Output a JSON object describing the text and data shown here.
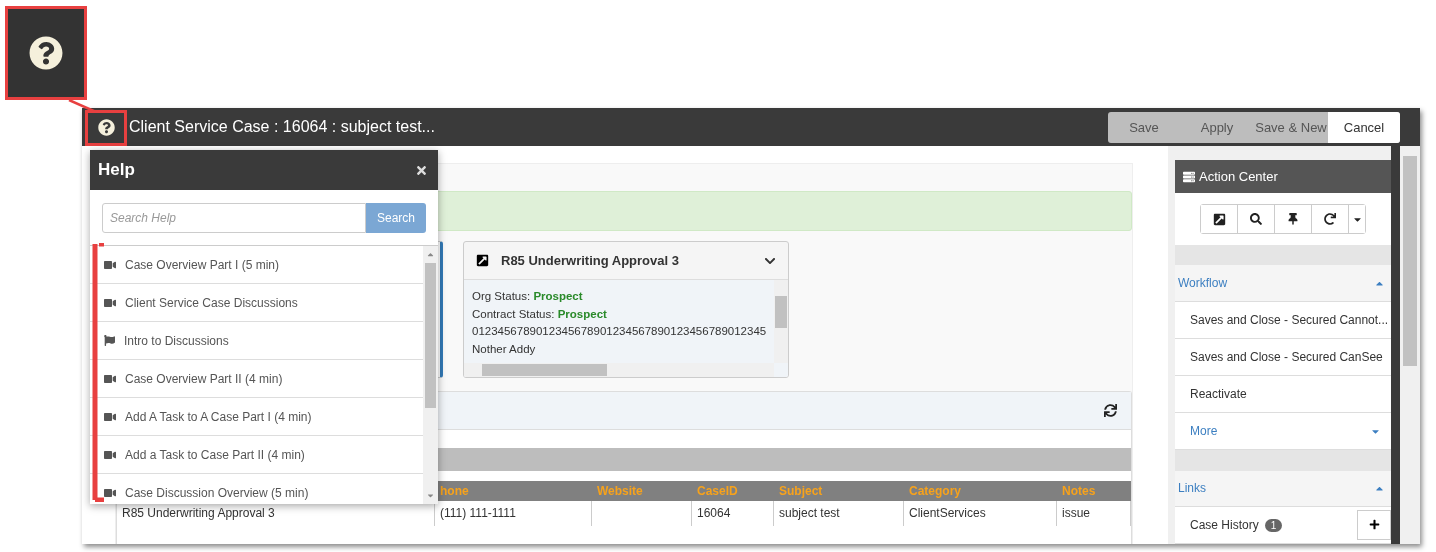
{
  "window": {
    "title": "Client Service Case : 16064 : subject test...",
    "buttons": [
      {
        "label": "Save",
        "kind": "default"
      },
      {
        "label": "Apply",
        "kind": "default"
      },
      {
        "label": "Save & New",
        "kind": "default"
      },
      {
        "label": "Cancel",
        "kind": "primary"
      }
    ]
  },
  "help": {
    "title": "Help",
    "search": {
      "placeholder": "Search Help",
      "button": "Search"
    },
    "items": [
      {
        "label": "Case Overview Part I (5 min)",
        "kind": "video"
      },
      {
        "label": "Client Service Case Discussions",
        "kind": "video"
      },
      {
        "label": "Intro to Discussions",
        "kind": "tour"
      },
      {
        "label": "Case Overview Part II (4 min)",
        "kind": "video"
      },
      {
        "label": "Add A Task to A Case Part I (4 min)",
        "kind": "video"
      },
      {
        "label": "Add a Task to Case Part II (4 min)",
        "kind": "video"
      },
      {
        "label": "Case Discussion Overview (5 min)",
        "kind": "video"
      }
    ]
  },
  "record_card": {
    "title": "R85 Underwriting Approval 3",
    "fields": [
      {
        "label": "Org Status:",
        "value": "Prospect"
      },
      {
        "label": "Contract Status:",
        "value": "Prospect"
      }
    ],
    "lines": [
      "0123456789012345678901234567890123456789012345",
      "Nother Addy"
    ]
  },
  "table": {
    "columns": [
      "",
      "hone",
      "Website",
      "CaseID",
      "Subject",
      "Category",
      "Notes"
    ],
    "rows": [
      {
        "cells": [
          "R85 Underwriting Approval 3",
          "(111) 111-1111",
          null,
          "16064",
          "subject test",
          "ClientServices",
          "issue"
        ]
      }
    ]
  },
  "action_center": {
    "title": "Action Center",
    "tools": [
      {
        "kind": "open"
      },
      {
        "kind": "search"
      },
      {
        "kind": "pin"
      },
      {
        "kind": "refresh"
      },
      {
        "kind": "dropdown"
      }
    ],
    "sections": [
      {
        "title": "Workflow",
        "expanded": true,
        "items": [
          {
            "label": "Saves and Close - Secured Cannot..."
          },
          {
            "label": "Saves and Close - Secured CanSee"
          },
          {
            "label": "Reactivate"
          }
        ],
        "more": "More"
      },
      {
        "title": "Links",
        "expanded": true,
        "items": [
          {
            "label": "Case History",
            "count": "1"
          }
        ]
      }
    ]
  }
}
